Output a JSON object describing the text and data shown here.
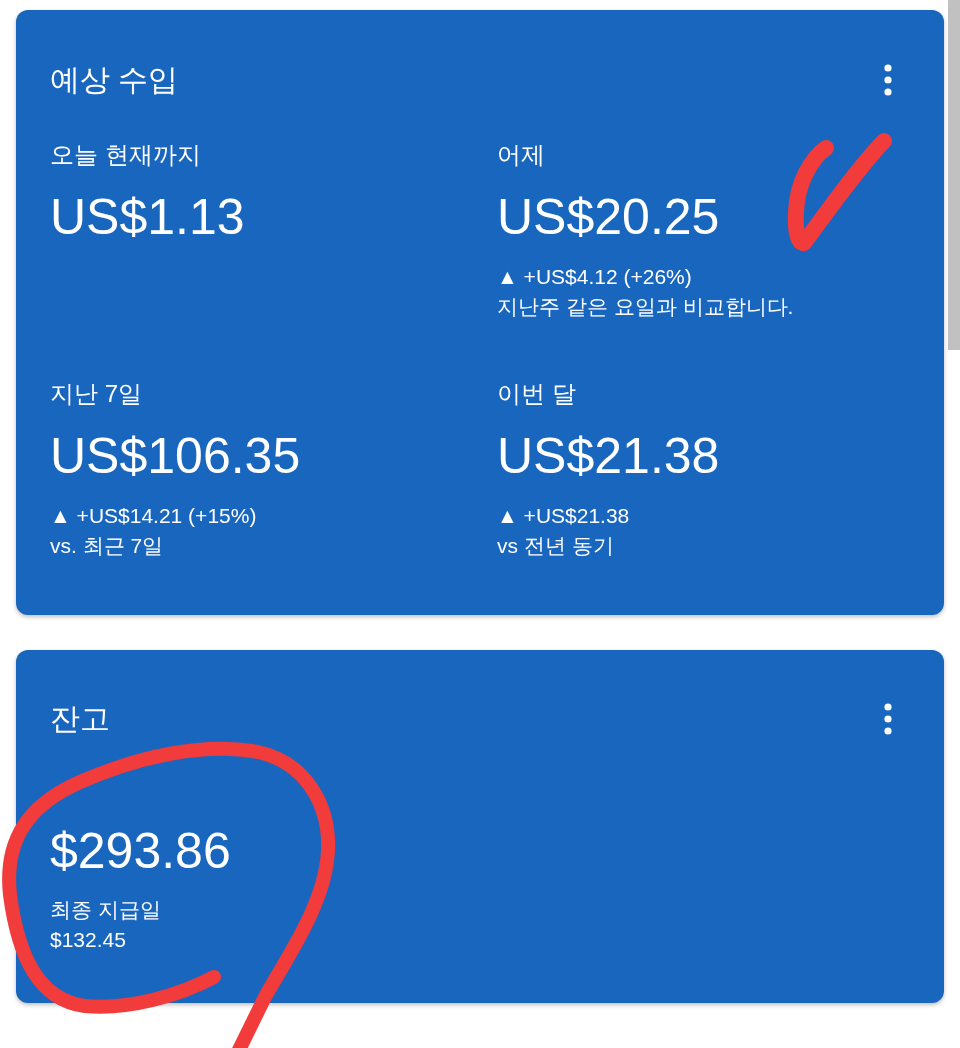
{
  "cards": [
    {
      "kind": "metrics",
      "title": "예상 수입",
      "metrics": [
        {
          "label": "오늘 현재까지",
          "value": "US$1.13"
        },
        {
          "label": "어제",
          "value": "US$20.25",
          "change": "▲ +US$4.12 (+26%)",
          "note": "지난주 같은 요일과 비교합니다."
        },
        {
          "label": "지난 7일",
          "value": "US$106.35",
          "change": "▲ +US$14.21 (+15%)",
          "note": "vs. 최근 7일"
        },
        {
          "label": "이번 달",
          "value": "US$21.38",
          "change": "▲ +US$21.38",
          "note": "vs 전년 동기"
        }
      ]
    },
    {
      "kind": "balance",
      "title": "잔고",
      "value": "$293.86",
      "label": "최종 지급일",
      "sub_value": "$132.45"
    }
  ]
}
